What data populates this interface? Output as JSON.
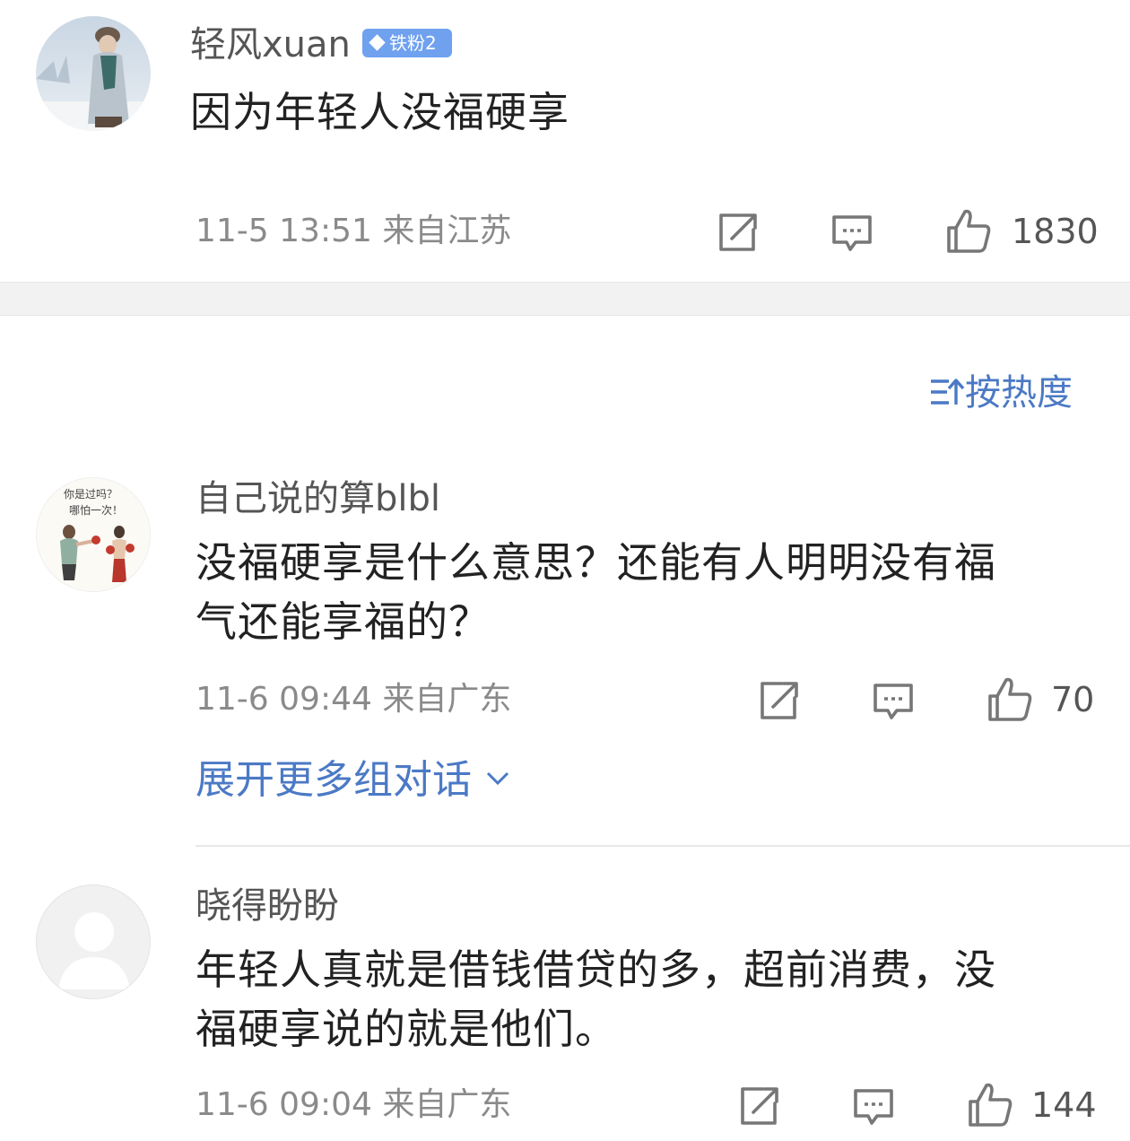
{
  "comments": [
    {
      "username": "轻风xuan",
      "badge": "铁粉2",
      "text": "因为年轻人没福硬享",
      "meta": "11-5 13:51  来自江苏",
      "likes": "1830",
      "avatar_icon": "avatar-winter-person-icon"
    },
    {
      "username": "自己说的算blbl",
      "text_line1": "没福硬享是什么意思？还能有人明明没有福",
      "text_line2": "气还能享福的？",
      "meta": "11-6 09:44  来自广东",
      "likes": "70",
      "avatar_icon": "avatar-boxing-illustration-icon",
      "avatar_caption_1": "你是过吗？",
      "avatar_caption_2": "哪怕一次！"
    },
    {
      "username": "晓得盼盼",
      "text_line1": "年轻人真就是借钱借贷的多，超前消费，没",
      "text_line2": "福硬享说的就是他们。",
      "meta": "11-6 09:04  来自广东",
      "likes": "144",
      "avatar_icon": "default-avatar-icon"
    }
  ],
  "sort_label": "按热度",
  "expand_label": "展开更多组对话",
  "colors": {
    "link_blue": "#4b79c5",
    "badge_blue": "#6fa1ef",
    "meta_gray": "#8a8a8a"
  }
}
